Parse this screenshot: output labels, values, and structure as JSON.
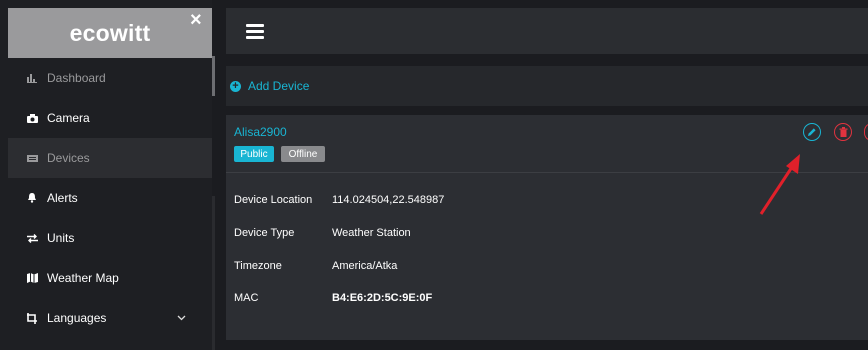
{
  "sidebar": {
    "logo": "ecowitt",
    "close_glyph": "×",
    "items": [
      {
        "label": "Dashboard",
        "icon": "bar-chart-icon",
        "glyph": "▮▮"
      },
      {
        "label": "Camera",
        "icon": "camera-icon",
        "glyph": "▰"
      },
      {
        "label": "Devices",
        "icon": "devices-icon",
        "glyph": "▤"
      },
      {
        "label": "Alerts",
        "icon": "bell-icon",
        "glyph": "🔔"
      },
      {
        "label": "Units",
        "icon": "swap-arrows-icon",
        "glyph": "⇆"
      },
      {
        "label": "Weather Map",
        "icon": "map-icon",
        "glyph": "🗺"
      },
      {
        "label": "Languages",
        "icon": "languages-icon",
        "glyph": "⇅"
      }
    ],
    "languages_chevron": "⌄"
  },
  "toolbar": {
    "add_device_label": "Add Device"
  },
  "device": {
    "name": "Alisa2900",
    "badges": {
      "public": "Public",
      "offline": "Offline"
    },
    "rows": [
      {
        "label": "Device Location",
        "value": "114.024504,22.548987"
      },
      {
        "label": "Device Type",
        "value": "Weather Station"
      },
      {
        "label": "Timezone",
        "value": "America/Atka"
      },
      {
        "label": "MAC",
        "value": "B4:E6:2D:5C:9E:0F"
      }
    ]
  },
  "colors": {
    "accent": "#19b5d3",
    "danger": "#e0333f",
    "annotation_arrow": "#e0202a"
  }
}
